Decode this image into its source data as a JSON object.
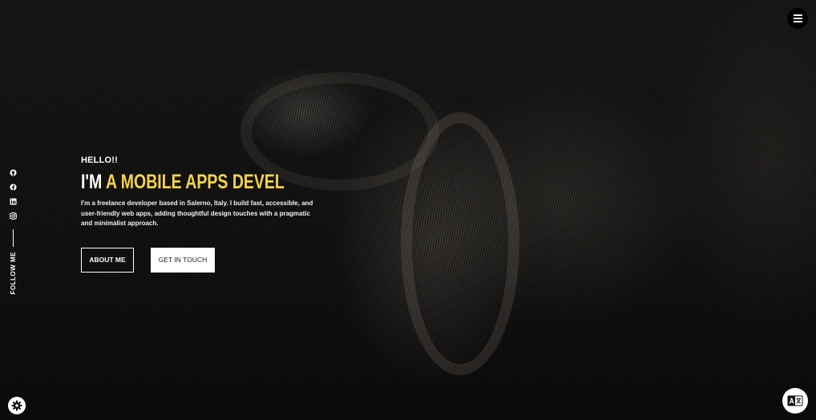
{
  "hero": {
    "greeting": "HELLO!!",
    "headline_prefix": "I'M",
    "headline_typed": "A MOBILE APPS DEVEL",
    "description": "I'm a freelance developer based in Salerno, Italy. I build fast, accessible, and user-friendly web apps, adding thoughtful design touches with a pragmatic and minimalist approach."
  },
  "buttons": {
    "about": "ABOUT ME",
    "contact": "GET IN TOUCH"
  },
  "social": {
    "label": "FOLLOW ME",
    "icons": [
      "github-icon",
      "facebook-icon",
      "linkedin-icon",
      "instagram-icon"
    ]
  },
  "controls": {
    "menu_icon": "hamburger-menu-icon",
    "settings_icon": "gear-icon",
    "language_icon": "translate-icon"
  },
  "colors": {
    "accent": "#f5d547",
    "background": "#0d0c0b",
    "text": "#ffffff"
  }
}
